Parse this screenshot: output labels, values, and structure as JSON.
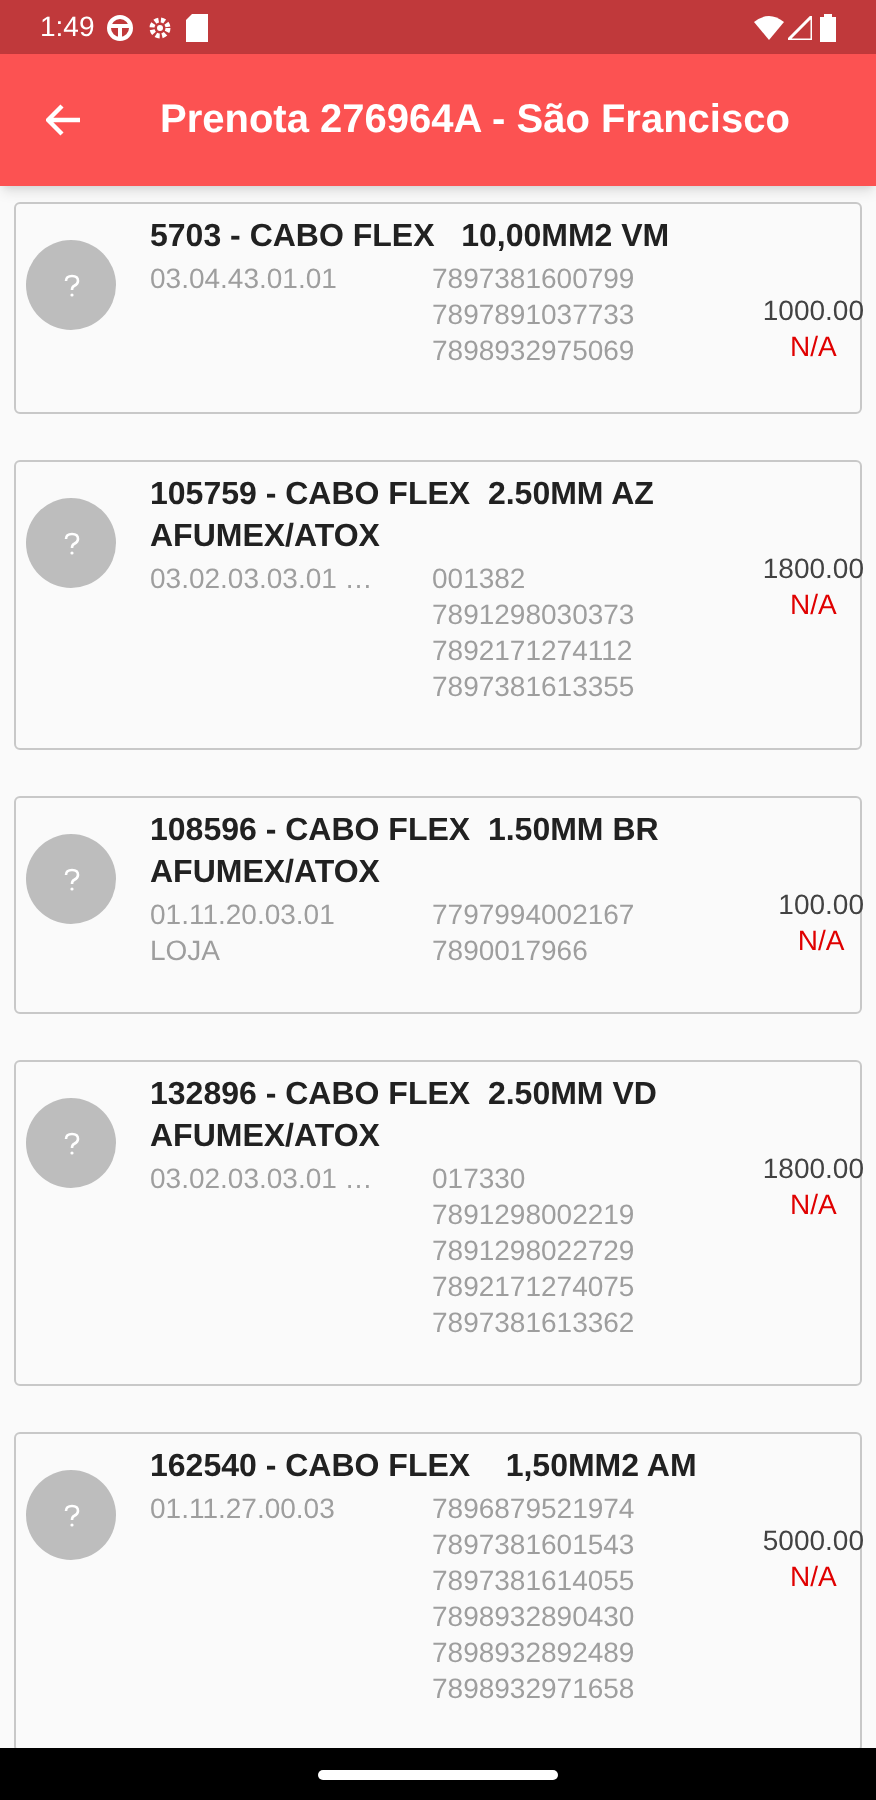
{
  "status_bar": {
    "time": "1:49"
  },
  "app_bar": {
    "title": "Prenota 276964A - São Francisco"
  },
  "items": [
    {
      "title": "5703 - CABO FLEX   10,00MM2 VM",
      "locations": [
        "03.04.43.01.01"
      ],
      "barcodes": [
        "7897381600799",
        "7897891037733",
        "7898932975069"
      ],
      "quantity": "1000.00",
      "status": "N/A"
    },
    {
      "title": "105759 - CABO FLEX  2.50MM AZ AFUMEX/ATOX",
      "locations": [
        "03.02.03.03.01 …"
      ],
      "barcodes": [
        "001382",
        "7891298030373",
        "7892171274112",
        "7897381613355"
      ],
      "quantity": "1800.00",
      "status": "N/A"
    },
    {
      "title": "108596 - CABO FLEX  1.50MM BR AFUMEX/ATOX",
      "locations": [
        "01.11.20.03.01",
        "LOJA"
      ],
      "barcodes": [
        "7797994002167",
        "7890017966"
      ],
      "quantity": "100.00",
      "status": "N/A"
    },
    {
      "title": "132896 - CABO FLEX  2.50MM VD AFUMEX/ATOX",
      "locations": [
        "03.02.03.03.01 …"
      ],
      "barcodes": [
        "017330",
        "7891298002219",
        "7891298022729",
        "7892171274075",
        "7897381613362"
      ],
      "quantity": "1800.00",
      "status": "N/A"
    },
    {
      "title": "162540 - CABO FLEX    1,50MM2 AM",
      "locations": [
        "01.11.27.00.03"
      ],
      "barcodes": [
        "7896879521974",
        "7897381601543",
        "7897381614055",
        "7898932890430",
        "7898932892489",
        "7898932971658"
      ],
      "quantity": "5000.00",
      "status": "N/A"
    }
  ]
}
